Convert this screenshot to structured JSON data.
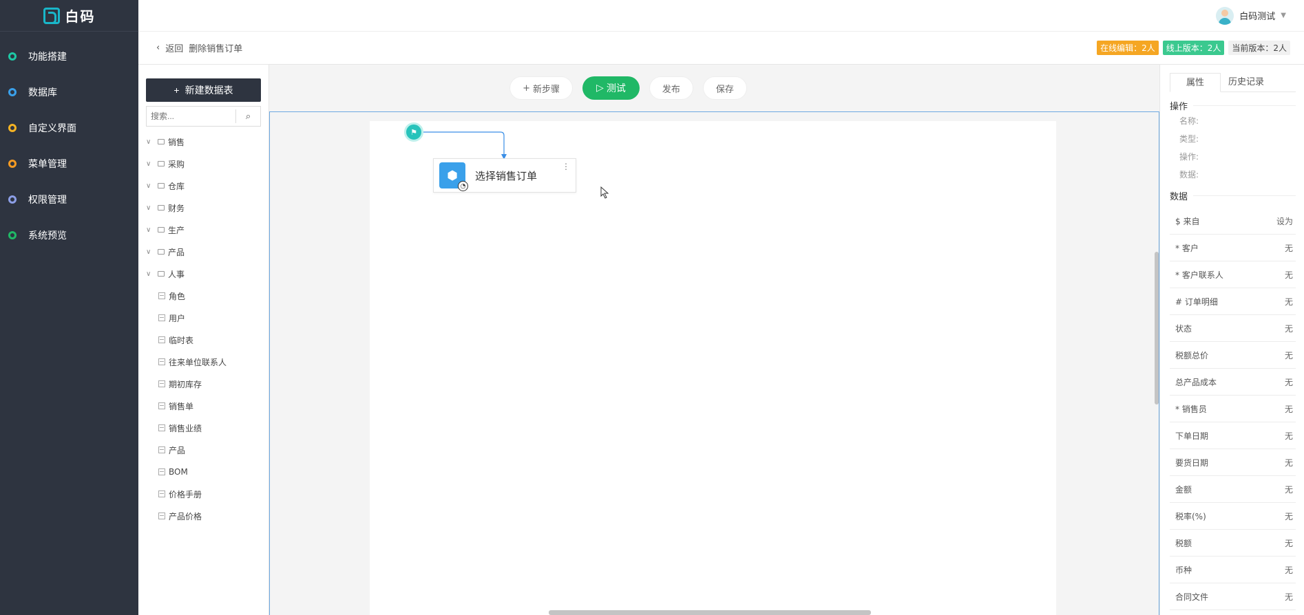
{
  "brand": {
    "name": "白码"
  },
  "nav": [
    {
      "label": "功能搭建",
      "color": "#1ec8a5"
    },
    {
      "label": "数据库",
      "color": "#3aa0ea"
    },
    {
      "label": "自定义界面",
      "color": "#f5b324"
    },
    {
      "label": "菜单管理",
      "color": "#f59a23"
    },
    {
      "label": "权限管理",
      "color": "#8c9ee6"
    },
    {
      "label": "系统预览",
      "color": "#20b866"
    }
  ],
  "user": {
    "name": "白码测试"
  },
  "subbar": {
    "back_label": "返回",
    "title": "删除销售订单",
    "badges": [
      {
        "label": "在线编辑：2人",
        "color": "#f5a623"
      },
      {
        "label": "线上版本：2人",
        "color": "#3bc98f"
      },
      {
        "label": "当前版本：2人",
        "color": "#f1f1f1"
      }
    ]
  },
  "tree": {
    "new_table_label": "新建数据表",
    "search_placeholder": "搜索...",
    "folders": [
      "销售",
      "采购",
      "仓库",
      "财务",
      "生产",
      "产品",
      "人事"
    ],
    "tables": [
      "角色",
      "用户",
      "临时表",
      "往来单位联系人",
      "期初库存",
      "销售单",
      "销售业绩",
      "产品",
      "BOM",
      "价格手册",
      "产品价格"
    ]
  },
  "toolbar": {
    "new_step": "新步骤",
    "test": "测试",
    "publish": "发布",
    "save": "保存"
  },
  "flow": {
    "node_title": "选择销售订单"
  },
  "props": {
    "tabs": [
      "属性",
      "历史记录"
    ],
    "op_section": "操作",
    "op_fields": [
      "名称:",
      "类型:",
      "操作:",
      "数据:"
    ],
    "data_section": "数据",
    "fields": [
      {
        "label": "$ 来自",
        "value": "设为"
      },
      {
        "label": "* 客户",
        "value": "无"
      },
      {
        "label": "* 客户联系人",
        "value": "无"
      },
      {
        "label": "# 订单明细",
        "value": "无"
      },
      {
        "label": "状态",
        "value": "无"
      },
      {
        "label": "税额总价",
        "value": "无"
      },
      {
        "label": "总产品成本",
        "value": "无"
      },
      {
        "label": "* 销售员",
        "value": "无"
      },
      {
        "label": "下单日期",
        "value": "无"
      },
      {
        "label": "要货日期",
        "value": "无"
      },
      {
        "label": "金额",
        "value": "无"
      },
      {
        "label": "税率(%)",
        "value": "无"
      },
      {
        "label": "税额",
        "value": "无"
      },
      {
        "label": "币种",
        "value": "无"
      },
      {
        "label": "合同文件",
        "value": "无"
      }
    ]
  }
}
